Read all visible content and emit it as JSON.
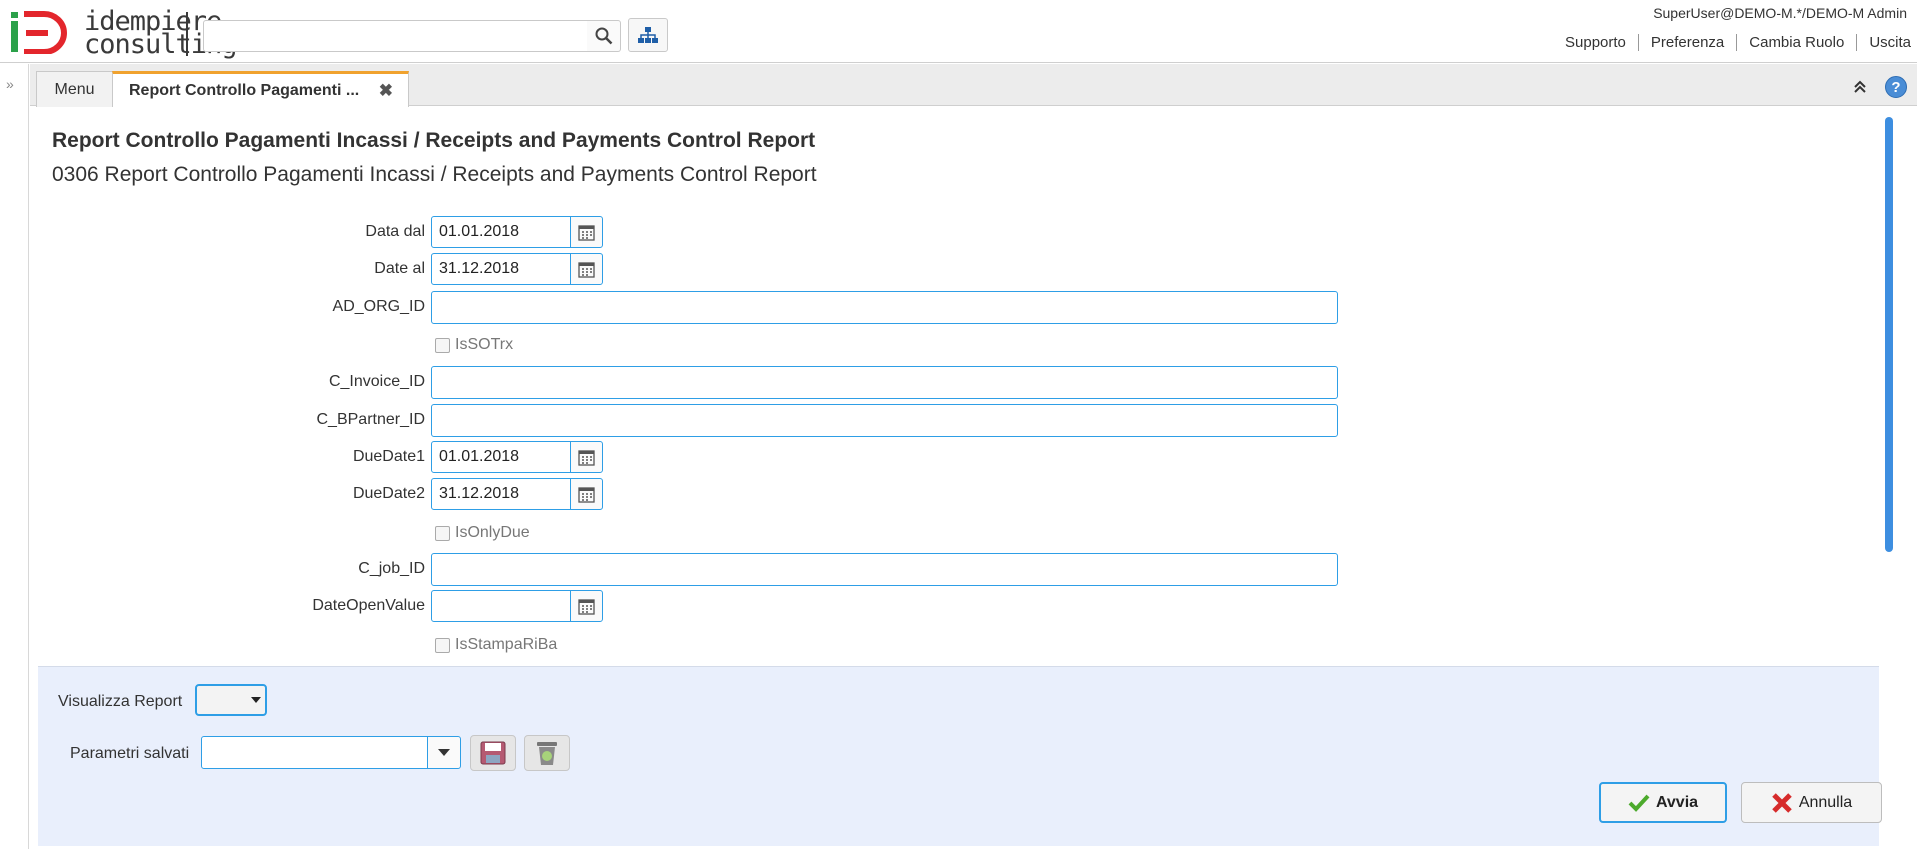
{
  "app": {
    "logo_text_line1": "idempiere",
    "logo_text_line2": "consulting",
    "user": "SuperUser@DEMO-M.*/DEMO-M Admin",
    "links": [
      "Supporto",
      "Preferenza",
      "Cambia Ruolo",
      "Uscita"
    ],
    "search_placeholder": ""
  },
  "tabs": {
    "menu_label": "Menu",
    "active_label": "Report Controllo Pagamenti ..."
  },
  "form": {
    "title": "Report Controllo Pagamenti Incassi / Receipts and Payments Control Report",
    "subtitle": "0306 Report Controllo Pagamenti Incassi / Receipts and Payments Control Report",
    "fields": {
      "data_dal": {
        "label": "Data dal",
        "value": "01.01.2018"
      },
      "date_al": {
        "label": "Date al",
        "value": "31.12.2018"
      },
      "ad_org_id": {
        "label": "AD_ORG_ID",
        "value": ""
      },
      "is_so_trx": {
        "label": "IsSOTrx",
        "checked": false
      },
      "c_invoice_id": {
        "label": "C_Invoice_ID",
        "value": ""
      },
      "c_bpartner_id": {
        "label": "C_BPartner_ID",
        "value": ""
      },
      "due_date1": {
        "label": "DueDate1",
        "value": "01.01.2018"
      },
      "due_date2": {
        "label": "DueDate2",
        "value": "31.12.2018"
      },
      "is_only_due": {
        "label": "IsOnlyDue",
        "checked": false
      },
      "c_job_id": {
        "label": "C_job_ID",
        "value": ""
      },
      "date_open_value": {
        "label": "DateOpenValue",
        "value": ""
      },
      "is_stampa_riba": {
        "label": "IsStampaRiBa",
        "checked": false
      }
    }
  },
  "bottom": {
    "visualizza_label": "Visualizza Report",
    "visualizza_value": "",
    "parametri_label": "Parametri salvati",
    "parametri_value": "",
    "run_label": "Avvia",
    "cancel_label": "Annulla"
  },
  "colors": {
    "accent": "#2e9ee6",
    "tab_highlight": "#f0a22e",
    "bottom_panel": "#e9effc",
    "logo_green": "#2ba14a",
    "logo_red": "#e3262c"
  }
}
